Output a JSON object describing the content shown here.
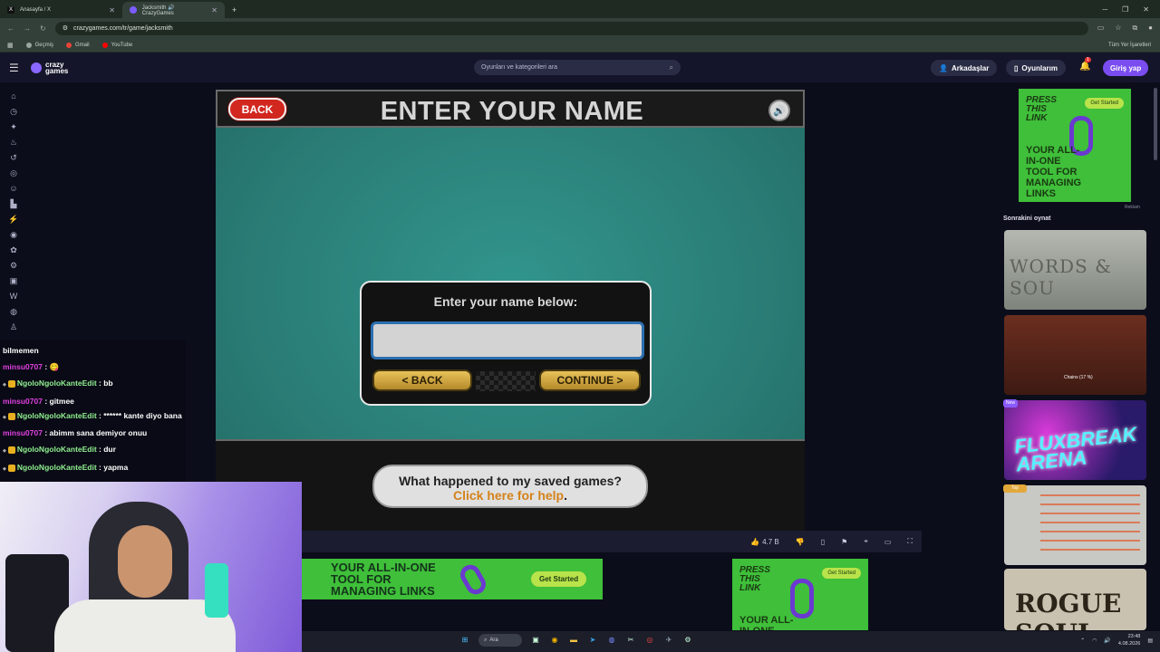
{
  "browser": {
    "tabs": [
      {
        "label": "Anasayfa / X",
        "icon": "x-logo-icon"
      },
      {
        "label": "Jacksmith 🔊 CrazyGames",
        "icon": "crazygames-icon"
      }
    ],
    "new_tab": "+",
    "url": "crazygames.com/tr/game/jacksmith",
    "bookmarks": [
      {
        "label": "Geçmiş",
        "color": "#9aa69e"
      },
      {
        "label": "Gmail",
        "color": "#ea4335"
      },
      {
        "label": "YouTube",
        "color": "#ff0000"
      }
    ],
    "all_bookmarks": "Tüm Yer İşaretleri"
  },
  "site_header": {
    "logo_line1": "crazy",
    "logo_line2": "games",
    "search_placeholder": "Oyunları ve kategorileri ara",
    "friends": "Arkadaşlar",
    "my_games": "Oyunlarım",
    "notification_count": "1",
    "login": "Giriş yap"
  },
  "sidebar_icons": [
    "home-icon",
    "recent-icon",
    "new-icon",
    "trending-icon",
    "updated-icon",
    "originals-icon",
    "multiplayer-icon",
    "action-icon",
    "adventure-icon",
    "basketball-icon",
    "beauty-icon",
    "bike-icon",
    "car-icon",
    "card-icon",
    "casual-icon",
    "clicker-icon"
  ],
  "game": {
    "back_top": "BACK",
    "title": "ENTER YOUR NAME",
    "sound_icon": "🔊",
    "prompt": "Enter your name below:",
    "name_value": "",
    "back_button": "< BACK",
    "continue_button": "CONTINUE >",
    "saved_question": "What happened to my saved games?",
    "saved_link": "Click here for help",
    "saved_period": "."
  },
  "game_toolbar": {
    "rating": "4.7 B"
  },
  "ads": {
    "banner_text": "YOUR ALL-IN-ONE TOOL FOR MANAGING LINKS",
    "cta": "Get Started",
    "press_title": "PRESS THIS LINK",
    "tile_body": "YOUR ALL-IN-ONE TOOL FOR MANAGING LINKS",
    "tile_body_short": "YOUR ALL-IN-ONE",
    "label": "Reklam",
    "brand_color": "#3fbf3a"
  },
  "right_rail": {
    "title": "Sonrakini oynat",
    "thumbs": [
      {
        "text": "WORDS & SOU"
      },
      {
        "text": "Chains (17 %)"
      },
      {
        "text": "FLUXBREAK ARENA",
        "badge": "New"
      },
      {
        "text": "",
        "badge": "Top"
      },
      {
        "text": "ROGUE SOUL"
      }
    ]
  },
  "chat": [
    {
      "user": "",
      "text": "bilmemen"
    },
    {
      "user": "minsu0707",
      "text": " : 😋",
      "color": "pink"
    },
    {
      "user": "NgoloNgoloKanteEdit",
      "text": " : bb",
      "color": "green",
      "badges": true
    },
    {
      "user": "minsu0707",
      "text": " : gitmee",
      "color": "pink"
    },
    {
      "user": "NgoloNgoloKanteEdit",
      "text": " : ****** kante diyo bana",
      "color": "green",
      "badges": true
    },
    {
      "user": "minsu0707",
      "text": " : abimm sana demiyor onuu",
      "color": "pink"
    },
    {
      "user": "NgoloNgoloKanteEdit",
      "text": " : dur",
      "color": "green",
      "badges": true
    },
    {
      "user": "NgoloNgoloKanteEdit",
      "text": " : yapma",
      "color": "green",
      "badges": true
    }
  ],
  "taskbar": {
    "search": "Ara",
    "time": "23:48",
    "date": "4.08.2026"
  }
}
